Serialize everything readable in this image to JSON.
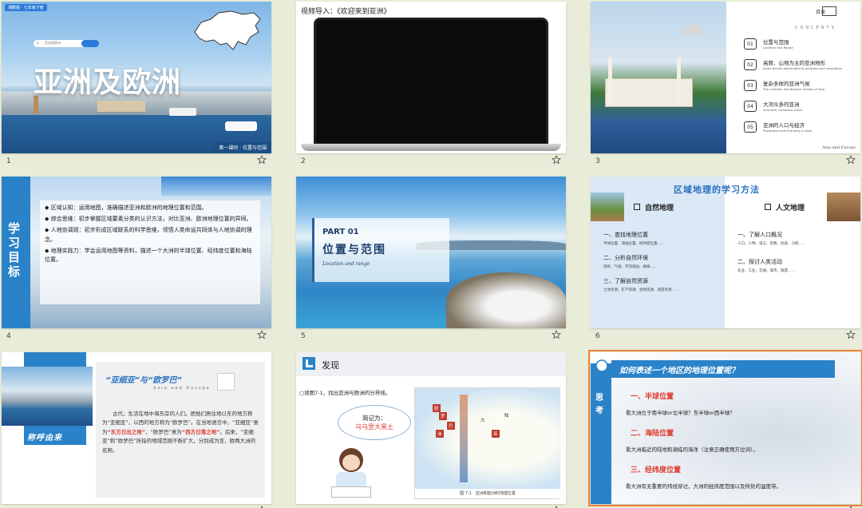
{
  "slides": [
    {
      "num": "1",
      "badge": "湘教版 · 七年级下册",
      "search": "亚洲及欧洲",
      "title": "亚洲及欧洲",
      "subtitle": "第一课时 · 位置与范围"
    },
    {
      "num": "2",
      "caption": "视频导入：《欢迎来到亚洲》"
    },
    {
      "num": "3",
      "heading": "目录",
      "heading_en": "CONCENTS",
      "items": [
        {
          "n": "01",
          "cn": "位置与范围",
          "en": "Location and Range"
        },
        {
          "n": "02",
          "cn": "高原、山地为主的亚洲地形",
          "en": "Asian terrain dominated by plateaus and mountains"
        },
        {
          "n": "03",
          "cn": "复杂多样的亚洲气候",
          "en": "The complex and diverse climate of Asia"
        },
        {
          "n": "04",
          "cn": "大河众多的亚洲",
          "en": "Asia with numerous rivers"
        },
        {
          "n": "05",
          "cn": "亚洲的人口与经济",
          "en": "Population and Economy in Asia"
        }
      ],
      "footer": "Asia and Europe"
    },
    {
      "num": "4",
      "side_title": "学习目标",
      "bullets": [
        "◆ 区域认知：运用地图，准确描述亚洲和欧洲的地理位置和范围。",
        "◆ 综合思维：初步掌握区域要素分类的认识方法，对比亚洲、欧洲地理位置的异同。",
        "◆ 人地协调观：初步形成区域联系的科学思维，领悟人类命运共同体与人地协调的理念。",
        "◆ 地理实践力：学会运用地图等资料，描述一个大洲的半球位置、经纬度位置和海陆位置。"
      ]
    },
    {
      "num": "5",
      "part": "PART 01",
      "title": "位置与范围",
      "subtitle": "Location and range"
    },
    {
      "num": "6",
      "title": "区域地理的学习方法",
      "left_head": "自然地理",
      "left_items": [
        {
          "h": "一、查找地理位置",
          "d": "半球位置、海陆位置、经纬度位置……"
        },
        {
          "h": "二、分析自然环境",
          "d": "地形、气候、河流湖泊、植被……"
        },
        {
          "h": "三、了解自然资源",
          "d": "土地资源、矿产资源、生物资源、旅游资源……"
        }
      ],
      "right_head": "人文地理",
      "right_items": [
        {
          "h": "一、了解人口概况",
          "d": "人口、人种、语言、宗教、民族、习俗……"
        },
        {
          "h": "二、探讨人类活动",
          "d": "农业、工业、交通、城市、旅游……"
        }
      ]
    },
    {
      "num": "7",
      "title": "“亚细亚”与“欧罗巴”",
      "title_en": "Asia and Europe",
      "side_label": "称呼由来",
      "body_1": "古代，生活在地中海东岸的人们，把他们居住地以东的地方称为“亚细亚”，以西的地方称为“欧罗巴”。在当地语言中，“亚细亚”意为",
      "hl_1": "“东方日出之地”",
      "body_2": "，“欧罗巴”意为",
      "hl_2": "“西方日落之地”",
      "body_3": "。后来，“亚细亚”和“欧罗巴”所指的地域范围不断扩大，分别成为亚、欧两大洲的名称。"
    },
    {
      "num": "8",
      "header": "发现",
      "prompt": "读图7-1，找出亚洲与欧洲的分界线。",
      "bubble_1": "简记为：",
      "bubble_2": "乌乌里大黑土",
      "map_caption": "图 7-1　亚洲和欧洲的地理位置",
      "map_labels": [
        "欧",
        "罗",
        "巴",
        "洲",
        "亚",
        "大",
        "陆"
      ]
    },
    {
      "num": "9",
      "title": "如何表述一个地区的地理位置呢？",
      "side_label": "思考",
      "sections": [
        {
          "h": "一、半球位置",
          "d": "看大洲位于南半球or北半球？东半球or西半球？"
        },
        {
          "h": "二、海陆位置",
          "d": "看大洲临近的陆地和濒临的海洋（注意正确使用方位词）。"
        },
        {
          "h": "三、经纬度位置",
          "d": "看大洲有无重要的纬线穿过，大洲的经纬度范围以及所处的温度带。"
        }
      ]
    }
  ],
  "colors": {
    "accent": "#e8833a",
    "blue": "#2b7bd8",
    "red": "#e03c31",
    "dark_red": "#c0392b"
  }
}
